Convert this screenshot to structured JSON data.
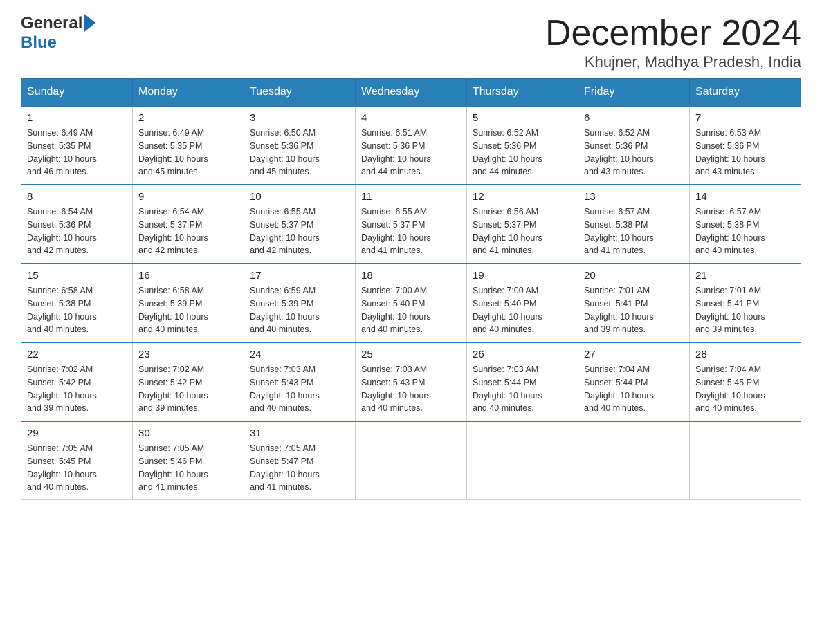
{
  "header": {
    "title": "December 2024",
    "location": "Khujner, Madhya Pradesh, India",
    "logo_general": "General",
    "logo_blue": "Blue"
  },
  "days_of_week": [
    "Sunday",
    "Monday",
    "Tuesday",
    "Wednesday",
    "Thursday",
    "Friday",
    "Saturday"
  ],
  "weeks": [
    [
      {
        "day": "1",
        "sunrise": "6:49 AM",
        "sunset": "5:35 PM",
        "daylight": "10 hours and 46 minutes."
      },
      {
        "day": "2",
        "sunrise": "6:49 AM",
        "sunset": "5:35 PM",
        "daylight": "10 hours and 45 minutes."
      },
      {
        "day": "3",
        "sunrise": "6:50 AM",
        "sunset": "5:36 PM",
        "daylight": "10 hours and 45 minutes."
      },
      {
        "day": "4",
        "sunrise": "6:51 AM",
        "sunset": "5:36 PM",
        "daylight": "10 hours and 44 minutes."
      },
      {
        "day": "5",
        "sunrise": "6:52 AM",
        "sunset": "5:36 PM",
        "daylight": "10 hours and 44 minutes."
      },
      {
        "day": "6",
        "sunrise": "6:52 AM",
        "sunset": "5:36 PM",
        "daylight": "10 hours and 43 minutes."
      },
      {
        "day": "7",
        "sunrise": "6:53 AM",
        "sunset": "5:36 PM",
        "daylight": "10 hours and 43 minutes."
      }
    ],
    [
      {
        "day": "8",
        "sunrise": "6:54 AM",
        "sunset": "5:36 PM",
        "daylight": "10 hours and 42 minutes."
      },
      {
        "day": "9",
        "sunrise": "6:54 AM",
        "sunset": "5:37 PM",
        "daylight": "10 hours and 42 minutes."
      },
      {
        "day": "10",
        "sunrise": "6:55 AM",
        "sunset": "5:37 PM",
        "daylight": "10 hours and 42 minutes."
      },
      {
        "day": "11",
        "sunrise": "6:55 AM",
        "sunset": "5:37 PM",
        "daylight": "10 hours and 41 minutes."
      },
      {
        "day": "12",
        "sunrise": "6:56 AM",
        "sunset": "5:37 PM",
        "daylight": "10 hours and 41 minutes."
      },
      {
        "day": "13",
        "sunrise": "6:57 AM",
        "sunset": "5:38 PM",
        "daylight": "10 hours and 41 minutes."
      },
      {
        "day": "14",
        "sunrise": "6:57 AM",
        "sunset": "5:38 PM",
        "daylight": "10 hours and 40 minutes."
      }
    ],
    [
      {
        "day": "15",
        "sunrise": "6:58 AM",
        "sunset": "5:38 PM",
        "daylight": "10 hours and 40 minutes."
      },
      {
        "day": "16",
        "sunrise": "6:58 AM",
        "sunset": "5:39 PM",
        "daylight": "10 hours and 40 minutes."
      },
      {
        "day": "17",
        "sunrise": "6:59 AM",
        "sunset": "5:39 PM",
        "daylight": "10 hours and 40 minutes."
      },
      {
        "day": "18",
        "sunrise": "7:00 AM",
        "sunset": "5:40 PM",
        "daylight": "10 hours and 40 minutes."
      },
      {
        "day": "19",
        "sunrise": "7:00 AM",
        "sunset": "5:40 PM",
        "daylight": "10 hours and 40 minutes."
      },
      {
        "day": "20",
        "sunrise": "7:01 AM",
        "sunset": "5:41 PM",
        "daylight": "10 hours and 39 minutes."
      },
      {
        "day": "21",
        "sunrise": "7:01 AM",
        "sunset": "5:41 PM",
        "daylight": "10 hours and 39 minutes."
      }
    ],
    [
      {
        "day": "22",
        "sunrise": "7:02 AM",
        "sunset": "5:42 PM",
        "daylight": "10 hours and 39 minutes."
      },
      {
        "day": "23",
        "sunrise": "7:02 AM",
        "sunset": "5:42 PM",
        "daylight": "10 hours and 39 minutes."
      },
      {
        "day": "24",
        "sunrise": "7:03 AM",
        "sunset": "5:43 PM",
        "daylight": "10 hours and 40 minutes."
      },
      {
        "day": "25",
        "sunrise": "7:03 AM",
        "sunset": "5:43 PM",
        "daylight": "10 hours and 40 minutes."
      },
      {
        "day": "26",
        "sunrise": "7:03 AM",
        "sunset": "5:44 PM",
        "daylight": "10 hours and 40 minutes."
      },
      {
        "day": "27",
        "sunrise": "7:04 AM",
        "sunset": "5:44 PM",
        "daylight": "10 hours and 40 minutes."
      },
      {
        "day": "28",
        "sunrise": "7:04 AM",
        "sunset": "5:45 PM",
        "daylight": "10 hours and 40 minutes."
      }
    ],
    [
      {
        "day": "29",
        "sunrise": "7:05 AM",
        "sunset": "5:45 PM",
        "daylight": "10 hours and 40 minutes."
      },
      {
        "day": "30",
        "sunrise": "7:05 AM",
        "sunset": "5:46 PM",
        "daylight": "10 hours and 41 minutes."
      },
      {
        "day": "31",
        "sunrise": "7:05 AM",
        "sunset": "5:47 PM",
        "daylight": "10 hours and 41 minutes."
      },
      null,
      null,
      null,
      null
    ]
  ],
  "labels": {
    "sunrise": "Sunrise:",
    "sunset": "Sunset:",
    "daylight": "Daylight:"
  }
}
